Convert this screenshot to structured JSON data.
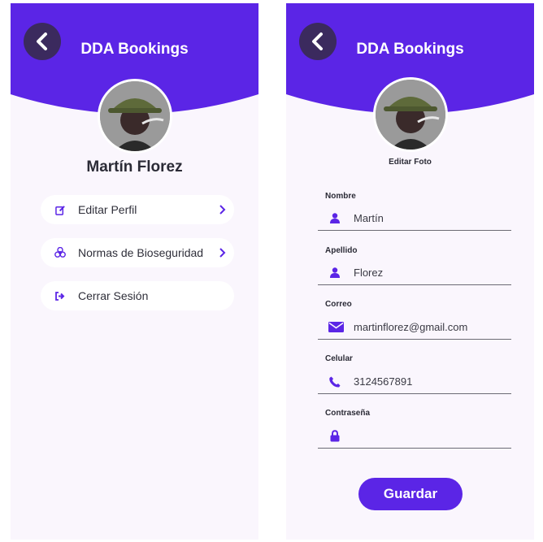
{
  "colors": {
    "primary": "#5b25e6",
    "back_button": "#3b2a5e",
    "background": "#faf6fd",
    "text": "#2b2b36"
  },
  "left_screen": {
    "title": "DDA Bookings",
    "user_name": "Martín Florez",
    "menu": [
      {
        "label": "Editar Perfil",
        "icon": "edit-icon",
        "has_chevron": true
      },
      {
        "label": "Normas de Bioseguridad",
        "icon": "biohazard-icon",
        "has_chevron": true
      },
      {
        "label": "Cerrar Sesión",
        "icon": "logout-icon",
        "has_chevron": false
      }
    ]
  },
  "right_screen": {
    "title": "DDA Bookings",
    "edit_photo_label": "Editar Foto",
    "fields": [
      {
        "label": "Nombre",
        "value": "Martín",
        "icon": "user-icon"
      },
      {
        "label": "Apellido",
        "value": "Florez",
        "icon": "user-icon"
      },
      {
        "label": "Correo",
        "value": "martinflorez@gmail.com",
        "icon": "envelope-icon"
      },
      {
        "label": "Celular",
        "value": "3124567891",
        "icon": "phone-icon"
      },
      {
        "label": "Contraseña",
        "value": "",
        "icon": "lock-icon"
      }
    ],
    "save_label": "Guardar"
  }
}
